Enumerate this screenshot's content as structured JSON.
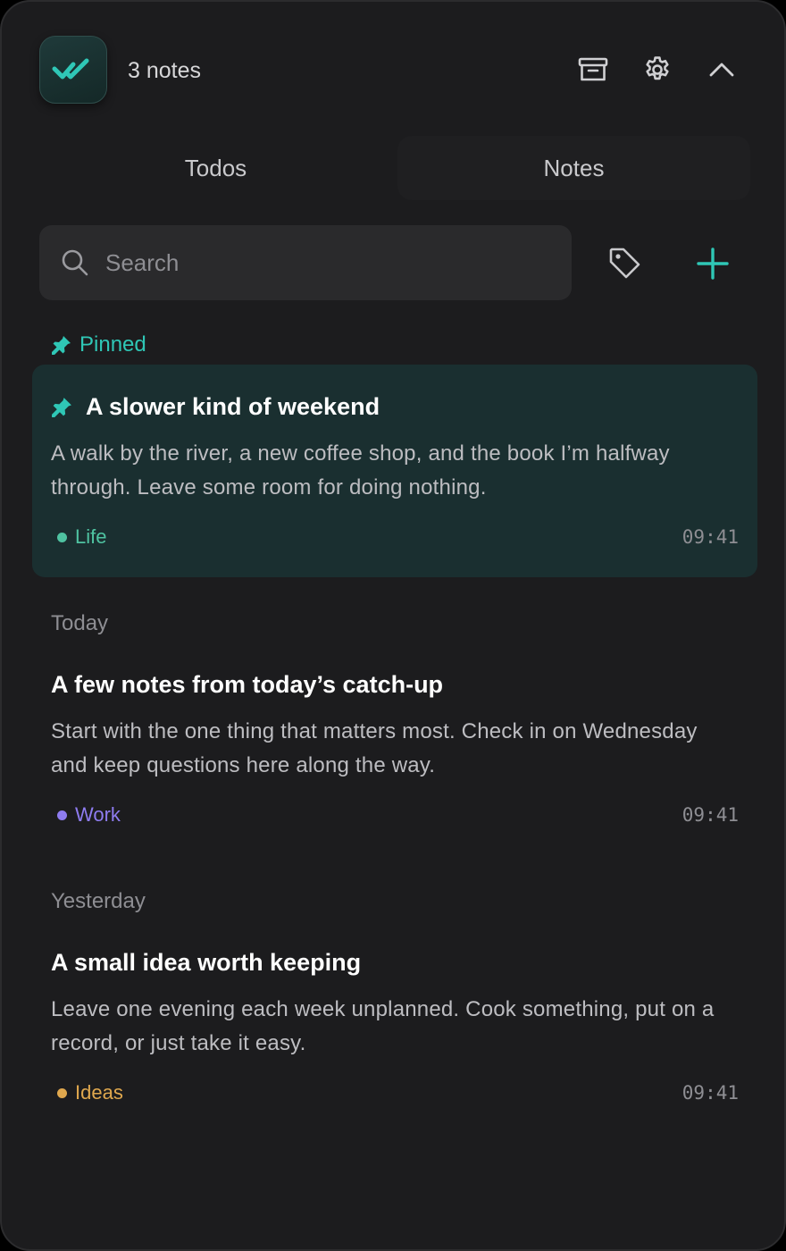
{
  "header": {
    "note_count": "3 notes",
    "logo_icon": "double-check-icon",
    "archive_icon": "archive-icon",
    "settings_icon": "gear-icon",
    "collapse_icon": "chevron-up-icon"
  },
  "tabs": [
    {
      "label": "Todos",
      "active": false
    },
    {
      "label": "Notes",
      "active": true
    }
  ],
  "search": {
    "placeholder": "Search",
    "value": ""
  },
  "sections": {
    "pinned": "Pinned",
    "today": "Today",
    "yesterday": "Yesterday"
  },
  "notes": [
    {
      "title": "A slower kind of weekend",
      "body": "A walk by the river, a new coffee shop, and the book I’m halfway through. Leave some room for doing nothing.",
      "tag": "Life",
      "tag_color": "#4fc3a1",
      "time": "09:41",
      "pinned": true
    },
    {
      "title": "A few notes from today’s catch-up",
      "body": "Start with the one thing that matters most. Check in on Wednesday and keep questions here along the way.",
      "tag": "Work",
      "tag_color": "#8e7cf0",
      "time": "09:41",
      "pinned": false
    },
    {
      "title": "A small idea worth keeping",
      "body": "Leave one evening each week unplanned. Cook something, put on a record, or just take it easy.",
      "tag": "Ideas",
      "tag_color": "#e0a84e",
      "time": "09:41",
      "pinned": false
    }
  ],
  "colors": {
    "accent": "#2fc7b6",
    "background": "#1c1c1e",
    "pinned_card": "#1a2f30"
  }
}
